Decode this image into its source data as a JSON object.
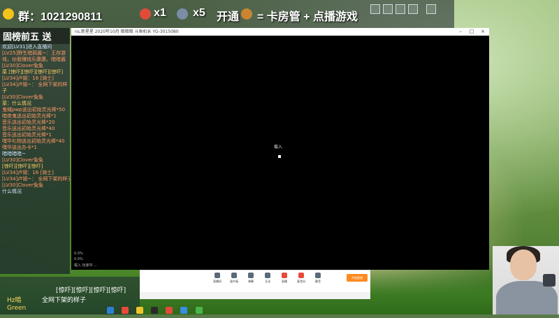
{
  "banner": {
    "group_label": "群：1021290811",
    "rocket_count": "x1",
    "plane_count": "x5",
    "open_text": "开通",
    "equals_text": "= 卡房管 + 点播游戏"
  },
  "chat": {
    "header": "固榜前五 送",
    "lines": [
      {
        "t": "欢迎[LV31]进入直播间",
        "c": "sys"
      },
      {
        "t": "[LV25]野生暗鸦酱~：王存游",
        "c": "gift"
      },
      {
        "t": "戏，炒股赚钱乐康康。暗暗酱",
        "c": "gift"
      },
      {
        "t": "[LV30]Clover兔兔",
        "c": "gift"
      },
      {
        "t": "菜 [惊吓][惊吓][惊吓][惊吓]",
        "c": ""
      },
      {
        "t": "[LV34]卢锡：16 [骑士]",
        "c": "gift"
      },
      {
        "t": "[LV34]卢锡~： 全网下架的样",
        "c": "gift"
      },
      {
        "t": "子",
        "c": ""
      },
      {
        "t": "[LV30]Clover兔兔",
        "c": "gift"
      },
      {
        "t": "菜：什么情况",
        "c": ""
      },
      {
        "t": "鬼蜮pwp送出初始灵光棒*50",
        "c": "gift"
      },
      {
        "t": "暗夜鬼送出初始灵光棒*1",
        "c": "gift"
      },
      {
        "t": "音乐送出初始灵光棒*20",
        "c": "gift"
      },
      {
        "t": "音乐送出初始灵光棒*40",
        "c": "gift"
      },
      {
        "t": "音乐送出初始灵光棒*1",
        "c": "gift"
      },
      {
        "t": "嘿华礼物送出初始灵光棒*40",
        "c": "gift"
      },
      {
        "t": "嘿华送出办卡*1",
        "c": "gift"
      },
      {
        "t": "暗暗暗暗~",
        "c": "sys"
      },
      {
        "t": "[LV30]Clover兔兔",
        "c": "gift"
      },
      {
        "t": "[惊吓][惊吓][惊吓]",
        "c": ""
      },
      {
        "t": "[LV34]卢锡：16 [骑士]",
        "c": "gift"
      },
      {
        "t": "[LV34]卢锡~： 全网下架的样子",
        "c": "gift"
      },
      {
        "t": "[LV30]Clover兔兔",
        "c": "gift"
      },
      {
        "t": "什么情况",
        "c": "sys"
      }
    ]
  },
  "window": {
    "title_text": "ns,新星星 2020年10月 暗暗暗 斗鱼机长 YG-3015080",
    "loading_text": "载入",
    "corner_line1": "0.0%",
    "corner_line2": "0.0%",
    "corner_line3": "载入 玩家中 ..."
  },
  "toolbar": {
    "items": [
      "直播间",
      "画中画",
      "弹幕",
      "互动",
      "直播",
      "开始直播",
      "关闭",
      "麦克风",
      "静音"
    ],
    "start_label": "开始直播"
  },
  "bottom": {
    "line1": "[惊吓][惊吓][惊吓][惊吓]",
    "line2": "全网下架的样子",
    "line3_name": "Hz暗",
    "line4_name": "Green"
  }
}
